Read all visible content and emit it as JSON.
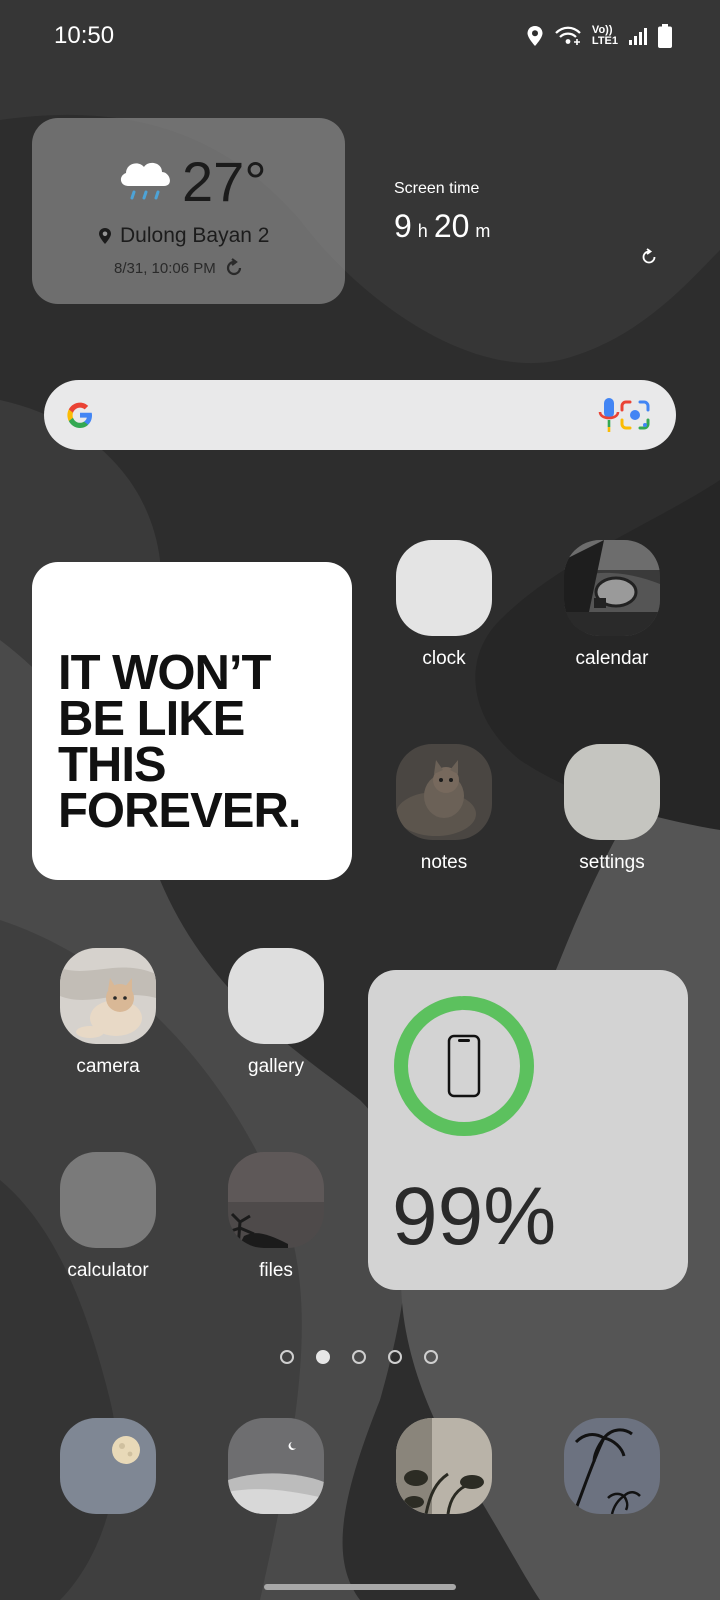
{
  "status_bar": {
    "time": "10:50",
    "network_top": "Vo))",
    "network_bottom": "LTE1"
  },
  "weather": {
    "temperature": "27°",
    "location": "Dulong Bayan 2",
    "updated": "8/31, 10:06 PM",
    "icon": "rain-cloud-icon"
  },
  "screen_time": {
    "label": "Screen time",
    "hours": "9",
    "hours_unit": "h",
    "minutes": "20",
    "minutes_unit": "m"
  },
  "search": {
    "provider": "google-logo",
    "voice_icon": "mic-icon",
    "lens_icon": "lens-icon"
  },
  "quote": {
    "text": "IT WON’T\nBE LIKE\nTHIS\nFOREVER."
  },
  "apps": [
    {
      "label": "clock"
    },
    {
      "label": "calendar"
    },
    {
      "label": "notes"
    },
    {
      "label": "settings"
    },
    {
      "label": "camera"
    },
    {
      "label": "gallery"
    },
    {
      "label": "calculator"
    },
    {
      "label": "files"
    }
  ],
  "battery": {
    "percent": "99%",
    "level": 0.99,
    "ring_color": "#5cc15e"
  },
  "pages": {
    "count": 5,
    "active": 2
  },
  "colors": {
    "background": "#2b2b2b",
    "widget_grey": "#d3d3d3",
    "accent_green": "#5cc15e"
  }
}
